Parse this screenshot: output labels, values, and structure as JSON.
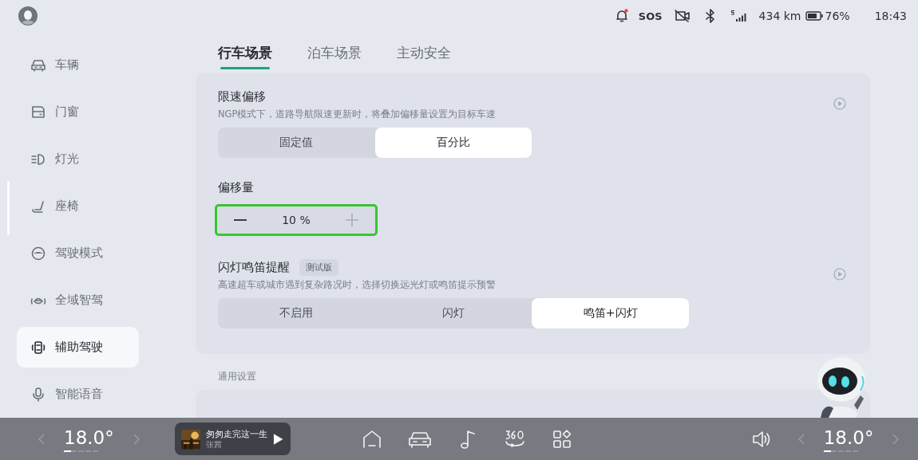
{
  "status_bar": {
    "notification_unread": true,
    "sos": "SOS",
    "range": "434 km",
    "battery": "76%",
    "time": "18:43"
  },
  "sidebar": {
    "items": [
      {
        "label": "车辆",
        "selected": false
      },
      {
        "label": "门窗",
        "selected": false
      },
      {
        "label": "灯光",
        "selected": false
      },
      {
        "label": "座椅",
        "selected": false
      },
      {
        "label": "驾驶模式",
        "selected": false
      },
      {
        "label": "全域智驾",
        "selected": false
      },
      {
        "label": "辅助驾驶",
        "selected": true
      },
      {
        "label": "智能语音",
        "selected": false
      }
    ]
  },
  "tabs": [
    {
      "label": "行车场景",
      "selected": true
    },
    {
      "label": "泊车场景",
      "selected": false
    },
    {
      "label": "主动安全",
      "selected": false
    }
  ],
  "sections": [
    {
      "kind": "segmented",
      "title": "限速偏移",
      "description": "NGP模式下，道路导航限速更新时，将叠加偏移量设置为目标车速",
      "video": true,
      "options": [
        {
          "label": "固定值",
          "selected": false
        },
        {
          "label": "百分比",
          "selected": true
        }
      ]
    },
    {
      "kind": "stepper",
      "title": "偏移量",
      "value": "10 %",
      "focused": true
    },
    {
      "kind": "segmented",
      "title": "闪灯鸣笛提醒",
      "badge": "测试版",
      "description": "高速超车或城市遇到复杂路况时，选择切换远光灯或鸣笛提示预警",
      "video": true,
      "options": [
        {
          "label": "不启用",
          "selected": false
        },
        {
          "label": "闪灯",
          "selected": false
        },
        {
          "label": "鸣笛+闪灯",
          "selected": true
        }
      ]
    }
  ],
  "general": {
    "heading": "通用设置"
  },
  "dock": {
    "left_temperature": {
      "value": "18.0°",
      "level": 0.2
    },
    "media": {
      "title": "匆匆走完这一生",
      "artist": "张茜"
    },
    "right_temperature": {
      "value": "18.0°",
      "level": 0.2
    }
  }
}
